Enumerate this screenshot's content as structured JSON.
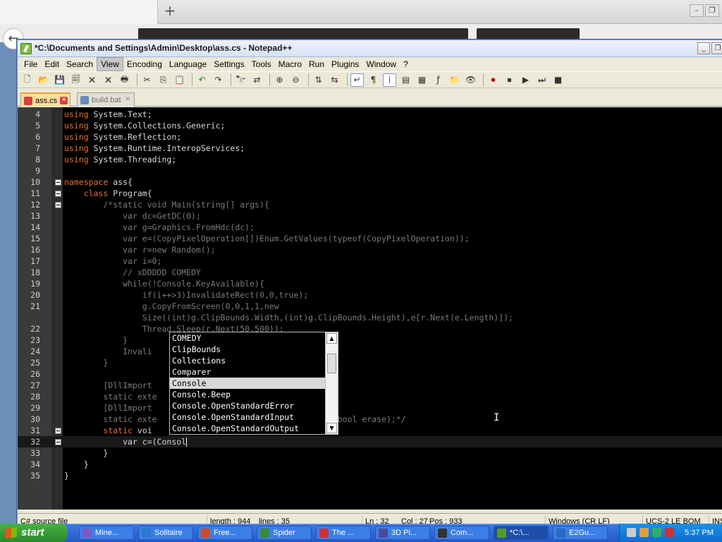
{
  "window": {
    "title": "*C:\\Documents and Settings\\Admin\\Desktop\\ass.cs - Notepad++",
    "controls": [
      "_",
      "❐",
      "✕"
    ]
  },
  "menu": [
    "File",
    "Edit",
    "Search",
    "View",
    "Encoding",
    "Language",
    "Settings",
    "Tools",
    "Macro",
    "Run",
    "Plugins",
    "Window",
    "?"
  ],
  "tabs": [
    {
      "label": "ass.cs",
      "active": true
    },
    {
      "label": "build.bat",
      "active": false
    }
  ],
  "code_lines": [
    {
      "n": "4",
      "fold": false,
      "parts": [
        [
          "kw",
          "using"
        ],
        [
          "t",
          " System.Text;"
        ]
      ]
    },
    {
      "n": "5",
      "fold": false,
      "parts": [
        [
          "kw",
          "using"
        ],
        [
          "t",
          " System.Collections.Generic;"
        ]
      ]
    },
    {
      "n": "6",
      "fold": false,
      "parts": [
        [
          "kw",
          "using"
        ],
        [
          "t",
          " System.Reflection;"
        ]
      ]
    },
    {
      "n": "7",
      "fold": false,
      "parts": [
        [
          "kw",
          "using"
        ],
        [
          "t",
          " System.Runtime.InteropServices;"
        ]
      ]
    },
    {
      "n": "8",
      "fold": false,
      "parts": [
        [
          "kw",
          "using"
        ],
        [
          "t",
          " System.Threading;"
        ]
      ]
    },
    {
      "n": "9",
      "fold": false,
      "parts": []
    },
    {
      "n": "10",
      "fold": true,
      "parts": [
        [
          "kw",
          "namespace"
        ],
        [
          "t",
          " ass{"
        ]
      ]
    },
    {
      "n": "11",
      "fold": true,
      "parts": [
        [
          "t",
          "    "
        ],
        [
          "kw",
          "class"
        ],
        [
          "t",
          " Program{"
        ]
      ]
    },
    {
      "n": "12",
      "fold": true,
      "parts": [
        [
          "cmt",
          "        /*static void Main(string[] args){"
        ]
      ]
    },
    {
      "n": "13",
      "fold": false,
      "parts": [
        [
          "cmt",
          "            var dc=GetDC(0);"
        ]
      ]
    },
    {
      "n": "14",
      "fold": false,
      "parts": [
        [
          "cmt",
          "            var g=Graphics.FromHdc(dc);"
        ]
      ]
    },
    {
      "n": "15",
      "fold": false,
      "parts": [
        [
          "cmt",
          "            var e=(CopyPixelOperation[])Enum.GetValues(typeof(CopyPixelOperation));"
        ]
      ]
    },
    {
      "n": "16",
      "fold": false,
      "parts": [
        [
          "cmt",
          "            var r=new Random();"
        ]
      ]
    },
    {
      "n": "17",
      "fold": false,
      "parts": [
        [
          "cmt",
          "            var i=0;"
        ]
      ]
    },
    {
      "n": "18",
      "fold": false,
      "parts": [
        [
          "cmt",
          "            // xDDDDD COMEDY"
        ]
      ]
    },
    {
      "n": "19",
      "fold": false,
      "parts": [
        [
          "cmt",
          "            while(!Console.KeyAvailable){"
        ]
      ]
    },
    {
      "n": "20",
      "fold": false,
      "parts": [
        [
          "cmt",
          "                if(i++>3)InvalidateRect(0,0,true);"
        ]
      ]
    },
    {
      "n": "21",
      "fold": false,
      "parts": [
        [
          "cmt",
          "                g.CopyFromScreen(0,0,1,1,new"
        ]
      ]
    },
    {
      "n": "",
      "fold": false,
      "parts": [
        [
          "cmt",
          "                Size((int)g.ClipBounds.Width,(int)g.ClipBounds.Height),e[r.Next(e.Length)]);"
        ]
      ]
    },
    {
      "n": "22",
      "fold": false,
      "parts": [
        [
          "cmt",
          "                Thread.Sleep(r.Next(50,500));"
        ]
      ]
    },
    {
      "n": "23",
      "fold": false,
      "parts": [
        [
          "cmt",
          "            }"
        ]
      ]
    },
    {
      "n": "24",
      "fold": false,
      "parts": [
        [
          "cmt",
          "            Invali"
        ]
      ]
    },
    {
      "n": "25",
      "fold": false,
      "parts": [
        [
          "cmt",
          "        }"
        ]
      ]
    },
    {
      "n": "26",
      "fold": false,
      "parts": []
    },
    {
      "n": "27",
      "fold": false,
      "parts": [
        [
          "cmt",
          "        [DllImport"
        ]
      ]
    },
    {
      "n": "28",
      "fold": false,
      "parts": [
        [
          "cmt",
          "        static exte"
        ]
      ]
    },
    {
      "n": "29",
      "fold": false,
      "parts": [
        [
          "cmt",
          "        [DllImport"
        ]
      ]
    },
    {
      "n": "30",
      "fold": false,
      "parts": [
        [
          "cmt",
          "        static exte                         ,int lprect,bool erase);*/"
        ]
      ]
    },
    {
      "n": "31",
      "fold": true,
      "parts": [
        [
          "t",
          "        "
        ],
        [
          "kw",
          "static"
        ],
        [
          "t",
          " voi"
        ]
      ]
    },
    {
      "n": "32",
      "fold": true,
      "current": true,
      "parts": [
        [
          "t",
          "            var c=(Consol"
        ]
      ]
    },
    {
      "n": "33",
      "fold": false,
      "parts": [
        [
          "t",
          "        }"
        ]
      ]
    },
    {
      "n": "34",
      "fold": false,
      "parts": [
        [
          "t",
          "    }"
        ]
      ]
    },
    {
      "n": "35",
      "fold": false,
      "parts": [
        [
          "t",
          "}"
        ]
      ]
    }
  ],
  "autocomplete": {
    "items": [
      "COMEDY",
      "ClipBounds",
      "Collections",
      "Comparer",
      "Console",
      "Console.Beep",
      "Console.OpenStandardError",
      "Console.OpenStandardInput",
      "Console.OpenStandardOutput"
    ],
    "selected": 4
  },
  "status": {
    "filetype": "C# source file",
    "length": "length : 944",
    "lines": "lines : 35",
    "ln": "Ln : 32",
    "col": "Col : 27",
    "pos": "Pos : 933",
    "eol": "Windows (CR LF)",
    "encoding": "UCS-2 LE BOM",
    "mode": "INS"
  },
  "taskbar": {
    "start": "start",
    "tasks": [
      "Mine...",
      "Solitaire",
      "Free...",
      "Spider",
      "The ...",
      "3D Pi...",
      "Com...",
      "*C:\\...",
      "E2Gu..."
    ],
    "clock": "5:37 PM"
  },
  "colors": {
    "keyword": "#e87030",
    "comment": "#7a7a7a",
    "text": "#d8d8d8",
    "editor_bg": "#000000"
  }
}
